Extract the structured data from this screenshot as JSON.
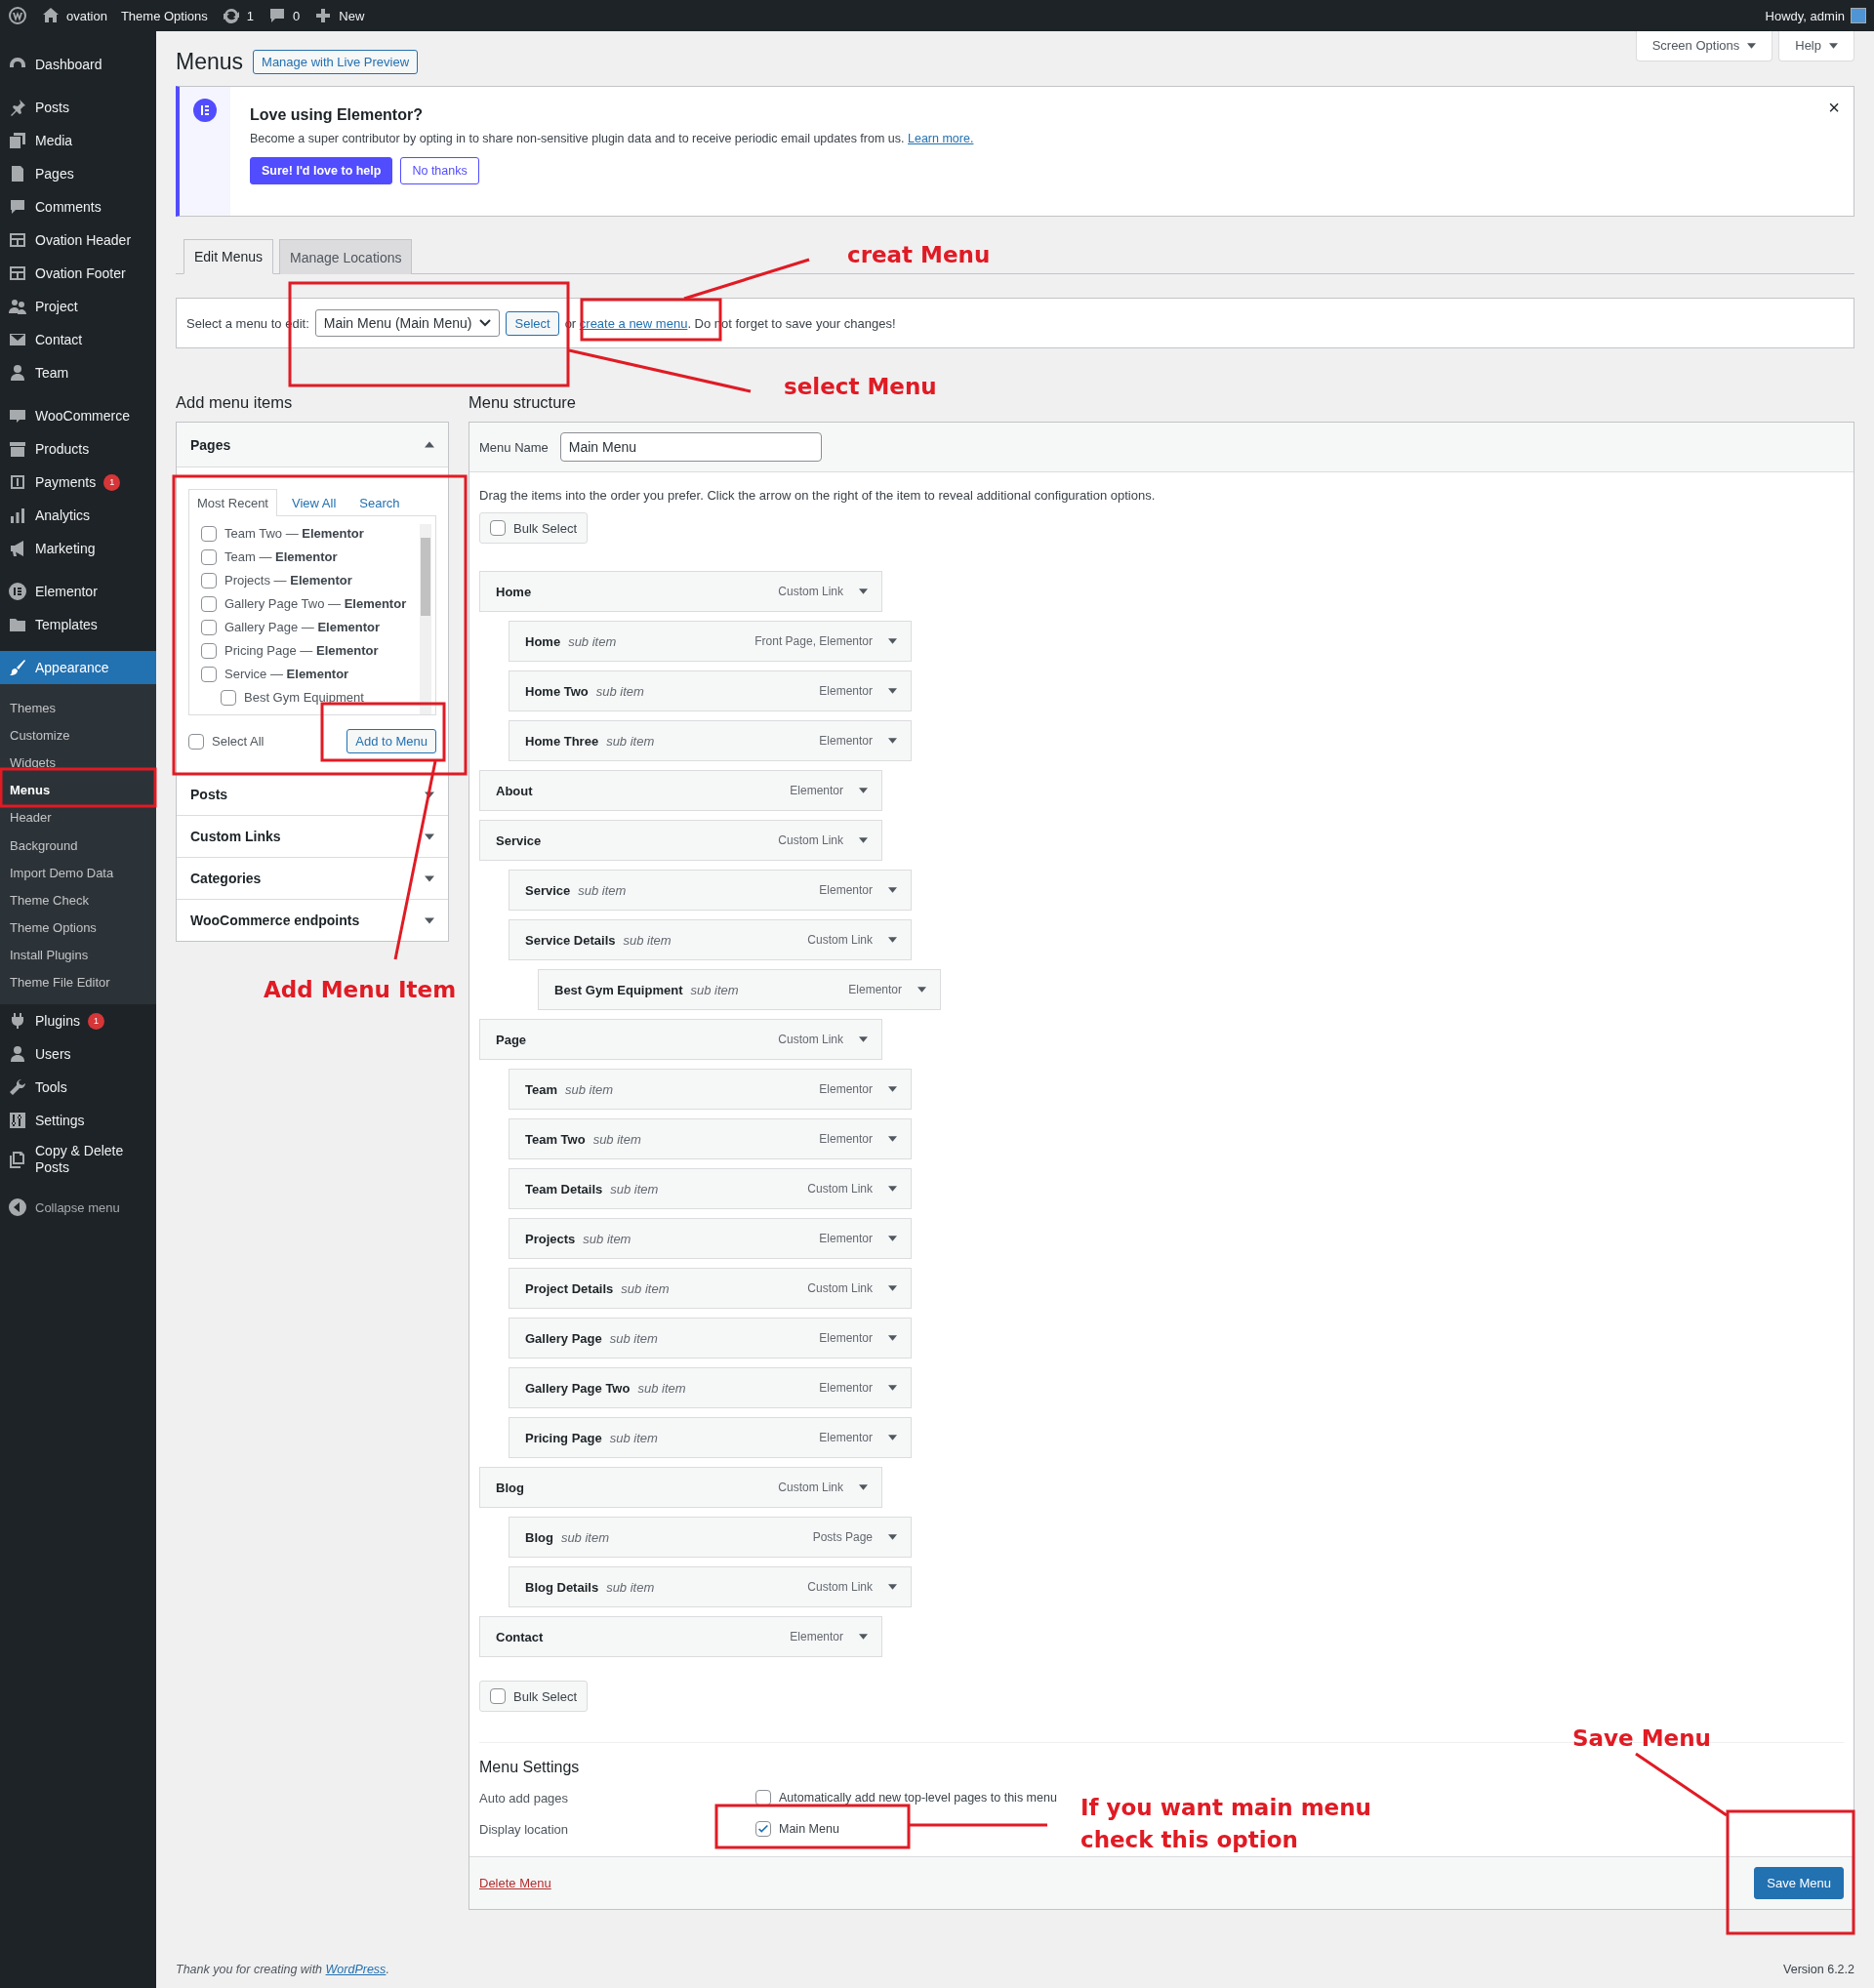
{
  "admin_bar": {
    "site": "ovation",
    "theme_options": "Theme Options",
    "updates": "1",
    "comments": "0",
    "new": "New",
    "greeting": "Howdy, admin"
  },
  "sidebar": {
    "groups": [
      [
        {
          "label": "Dashboard",
          "selected": false
        }
      ],
      [
        {
          "label": "Posts",
          "selected": false
        },
        {
          "label": "Media",
          "selected": false
        },
        {
          "label": "Pages",
          "selected": false
        },
        {
          "label": "Comments",
          "selected": false
        },
        {
          "label": "Ovation Header",
          "selected": false
        },
        {
          "label": "Ovation Footer",
          "selected": false
        },
        {
          "label": "Project",
          "selected": false
        },
        {
          "label": "Contact",
          "selected": false
        },
        {
          "label": "Team",
          "selected": false
        }
      ],
      [
        {
          "label": "WooCommerce",
          "selected": false
        },
        {
          "label": "Products",
          "selected": false
        },
        {
          "label": "Payments",
          "selected": false,
          "badge": "1"
        },
        {
          "label": "Analytics",
          "selected": false
        },
        {
          "label": "Marketing",
          "selected": false
        }
      ],
      [
        {
          "label": "Elementor",
          "selected": false
        },
        {
          "label": "Templates",
          "selected": false
        }
      ],
      [
        {
          "label": "Appearance",
          "selected": true,
          "children": [
            {
              "label": "Themes",
              "selected": false
            },
            {
              "label": "Customize",
              "selected": false
            },
            {
              "label": "Widgets",
              "selected": false
            },
            {
              "label": "Menus",
              "selected": true
            },
            {
              "label": "Header",
              "selected": false
            },
            {
              "label": "Background",
              "selected": false
            },
            {
              "label": "Import Demo Data",
              "selected": false
            },
            {
              "label": "Theme Check",
              "selected": false
            },
            {
              "label": "Theme Options",
              "selected": false
            },
            {
              "label": "Install Plugins",
              "selected": false
            },
            {
              "label": "Theme File Editor",
              "selected": false
            }
          ]
        },
        {
          "label": "Plugins",
          "selected": false,
          "badge": "1"
        },
        {
          "label": "Users",
          "selected": false
        },
        {
          "label": "Tools",
          "selected": false
        },
        {
          "label": "Settings",
          "selected": false
        },
        {
          "label": "Copy & Delete Posts",
          "selected": false
        }
      ]
    ],
    "collapse": "Collapse menu"
  },
  "header": {
    "title": "Menus",
    "action": "Manage with Live Preview",
    "screen_options": "Screen Options",
    "help": "Help"
  },
  "notice": {
    "title": "Love using Elementor?",
    "text": "Become a super contributor by opting in to share non-sensitive plugin data and to receive periodic email updates from us.",
    "link": "Learn more.",
    "buttons": [
      "Sure! I'd love to help",
      "No thanks"
    ],
    "close": "×"
  },
  "tabs": [
    {
      "label": "Edit Menus",
      "selected": true
    },
    {
      "label": "Manage Locations",
      "selected": false
    }
  ],
  "select_bar": {
    "label": "Select a menu to edit:",
    "dropdown": "Main Menu (Main Menu)",
    "button": "Select",
    "before": "or ",
    "link": "create a new menu",
    "after": ". Do not forget to save your changes!"
  },
  "add_items": {
    "heading": "Add menu items",
    "sections": [
      {
        "title": "Pages",
        "expanded": true,
        "separator": "—",
        "tabs": [
          {
            "label": "Most Recent",
            "selected": true
          },
          {
            "label": "View All",
            "selected": false
          },
          {
            "label": "Search",
            "selected": false
          }
        ],
        "pages": [
          {
            "title": "Team Two",
            "suffix": "Elementor",
            "checked": false
          },
          {
            "title": "Team",
            "suffix": "Elementor",
            "checked": false
          },
          {
            "title": "Projects",
            "suffix": "Elementor",
            "checked": false
          },
          {
            "title": "Gallery Page Two",
            "suffix": "Elementor",
            "checked": false
          },
          {
            "title": "Gallery Page",
            "suffix": "Elementor",
            "checked": false
          },
          {
            "title": "Pricing Page",
            "suffix": "Elementor",
            "checked": false
          },
          {
            "title": "Service",
            "suffix": "Elementor",
            "checked": false,
            "children": [
              {
                "title": "Best Gym Equipment",
                "checked": false
              }
            ]
          }
        ],
        "select_all": {
          "label": "Select All",
          "checked": false
        },
        "button": "Add to Menu"
      },
      {
        "title": "Posts",
        "expanded": false
      },
      {
        "title": "Custom Links",
        "expanded": false
      },
      {
        "title": "Categories",
        "expanded": false
      },
      {
        "title": "WooCommerce endpoints",
        "expanded": false
      }
    ]
  },
  "structure": {
    "heading": "Menu structure",
    "name_label": "Menu Name",
    "name_value": "Main Menu",
    "instructions": "Drag the items into the order you prefer. Click the arrow on the right of the item to reveal additional configuration options.",
    "bulk_top": {
      "label": "Bulk Select",
      "checked": false
    },
    "items": [
      {
        "title": "Home",
        "type": "Custom Link",
        "children": [
          {
            "title": "Home",
            "note": "sub item",
            "type": "Front Page, Elementor"
          },
          {
            "title": "Home Two",
            "note": "sub item",
            "type": "Elementor"
          },
          {
            "title": "Home Three",
            "note": "sub item",
            "type": "Elementor"
          }
        ]
      },
      {
        "title": "About",
        "type": "Elementor"
      },
      {
        "title": "Service",
        "type": "Custom Link",
        "children": [
          {
            "title": "Service",
            "note": "sub item",
            "type": "Elementor"
          },
          {
            "title": "Service Details",
            "note": "sub item",
            "type": "Custom Link",
            "children": [
              {
                "title": "Best Gym Equipment",
                "note": "sub item",
                "type": "Elementor"
              }
            ]
          }
        ]
      },
      {
        "title": "Page",
        "type": "Custom Link",
        "children": [
          {
            "title": "Team",
            "note": "sub item",
            "type": "Elementor"
          },
          {
            "title": "Team Two",
            "note": "sub item",
            "type": "Elementor"
          },
          {
            "title": "Team Details",
            "note": "sub item",
            "type": "Custom Link"
          },
          {
            "title": "Projects",
            "note": "sub item",
            "type": "Elementor"
          },
          {
            "title": "Project Details",
            "note": "sub item",
            "type": "Custom Link"
          },
          {
            "title": "Gallery Page",
            "note": "sub item",
            "type": "Elementor"
          },
          {
            "title": "Gallery Page Two",
            "note": "sub item",
            "type": "Elementor"
          },
          {
            "title": "Pricing Page",
            "note": "sub item",
            "type": "Elementor"
          }
        ]
      },
      {
        "title": "Blog",
        "type": "Custom Link",
        "children": [
          {
            "title": "Blog",
            "note": "sub item",
            "type": "Posts Page"
          },
          {
            "title": "Blog Details",
            "note": "sub item",
            "type": "Custom Link"
          }
        ]
      },
      {
        "title": "Contact",
        "type": "Elementor"
      }
    ],
    "bulk_bottom": {
      "label": "Bulk Select",
      "checked": false
    },
    "settings": {
      "heading": "Menu Settings",
      "rows": [
        {
          "label": "Auto add pages",
          "option": "Automatically add new top-level pages to this menu",
          "checked": false
        },
        {
          "label": "Display location",
          "option": "Main Menu",
          "checked": true
        }
      ]
    },
    "delete": "Delete Menu",
    "save": "Save Menu"
  },
  "footer": {
    "before": "Thank you for creating with ",
    "link": "WordPress",
    "after": ".",
    "version": "Version 6.2.2"
  },
  "annotations": [
    {
      "text": "creat Menu"
    },
    {
      "text": "select Menu"
    },
    {
      "text": "Add Menu Item"
    },
    {
      "text": "Save Menu"
    },
    {
      "text": "If you want main menu\ncheck this option"
    }
  ]
}
